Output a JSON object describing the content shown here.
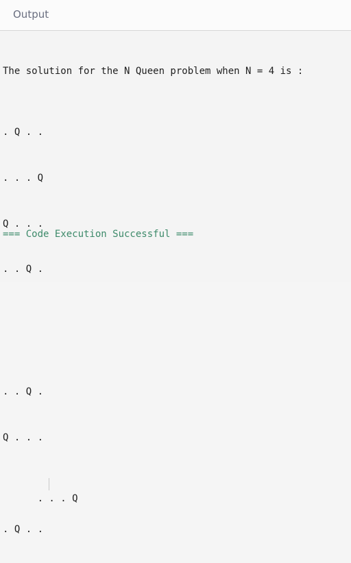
{
  "header": {
    "title": "Output"
  },
  "output": {
    "intro": "The solution for the N Queen problem when N = 4 is :",
    "solution_1": [
      ". Q . .",
      ". . . Q",
      "Q . . .",
      ". . Q ."
    ],
    "solution_2": [
      ". . Q .",
      "Q . . .",
      ". . . Q",
      ". Q . ."
    ],
    "status": "=== Code Execution Successful ==="
  },
  "colors": {
    "header_text": "#6a6f80",
    "success_text": "#3d8a6a"
  }
}
